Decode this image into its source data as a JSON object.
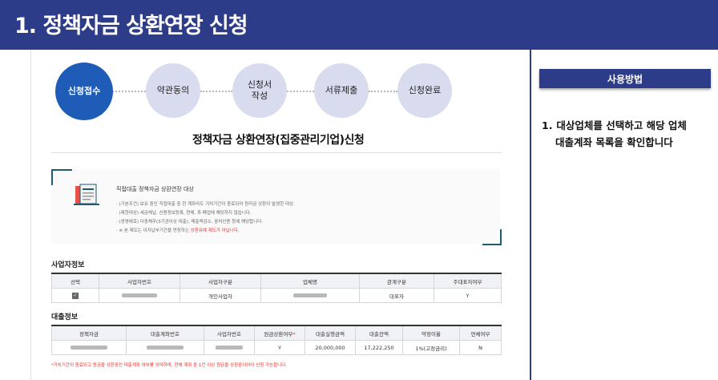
{
  "header": {
    "title": "1. 정책자금 상환연장 신청"
  },
  "steps": [
    {
      "label": "신청접수",
      "active": true
    },
    {
      "label": "약관동의"
    },
    {
      "label": "신청서\n작성"
    },
    {
      "label": "서류제출"
    },
    {
      "label": "신청완료"
    }
  ],
  "form_title": "정책자금 상환연장(집중관리기업)신청",
  "notice": {
    "heading": "직접대출 정책자금 상환연장 대상",
    "lines": [
      "· (기본조건) 보유 중인 직접대출 중 한 계좌라도 거치기간이 종료되어 원리금 상환이 발생한 대상.",
      "· (제한대상) 세금체납, 신용정보등록, 연체, 휴·폐업에 해당하지 않습니다.",
      "· (경영애로) 다중채무(3기관이상 대출), 매출액감소, 중처신용 등에 해당합니다."
    ],
    "last_prefix": "· ※ 본 제도는 이자납부기간을 연장하는 ",
    "last_red": "상환유예 제도가 아닙니다."
  },
  "biz_section": {
    "title": "사업자정보",
    "headers": [
      "선택",
      "사업자번호",
      "사업자구분",
      "업체명",
      "관계구분",
      "주대표자여부"
    ],
    "row": {
      "check": "✓",
      "biz_type": "개인사업자",
      "relation": "대표자",
      "main_rep": "Y"
    }
  },
  "loan_section": {
    "title": "대출정보",
    "headers": [
      "정책자금",
      "대출계좌번호",
      "사업자번호",
      "원금상환여부",
      "대출실행금액",
      "대출잔액",
      "약정이율",
      "연체여부"
    ],
    "required_mark": "*",
    "row": {
      "principal_repay": "Y",
      "exec_amount": "20,000,000",
      "balance": "17,222,250",
      "rate": "1%(고정금리)",
      "overdue": "N"
    }
  },
  "footnote": "*거치기간이 종료되고 원금을 상환중인 대출계좌 여부를 의미하며, 전체 계좌 중 1건 이상 원금을 상환중이어야 신청 가능합니다.",
  "right_panel": {
    "button": "사용방법",
    "instruction_num": "1.",
    "instruction_line1": "대상업체를 선택하고 해당 업체",
    "instruction_line2": "대출계좌 목록을 확인합니다"
  },
  "colors": {
    "brand": "#2d3c88",
    "active_step": "#1f5cb8",
    "step": "#d9dcef",
    "accent_red": "#e0312d"
  }
}
